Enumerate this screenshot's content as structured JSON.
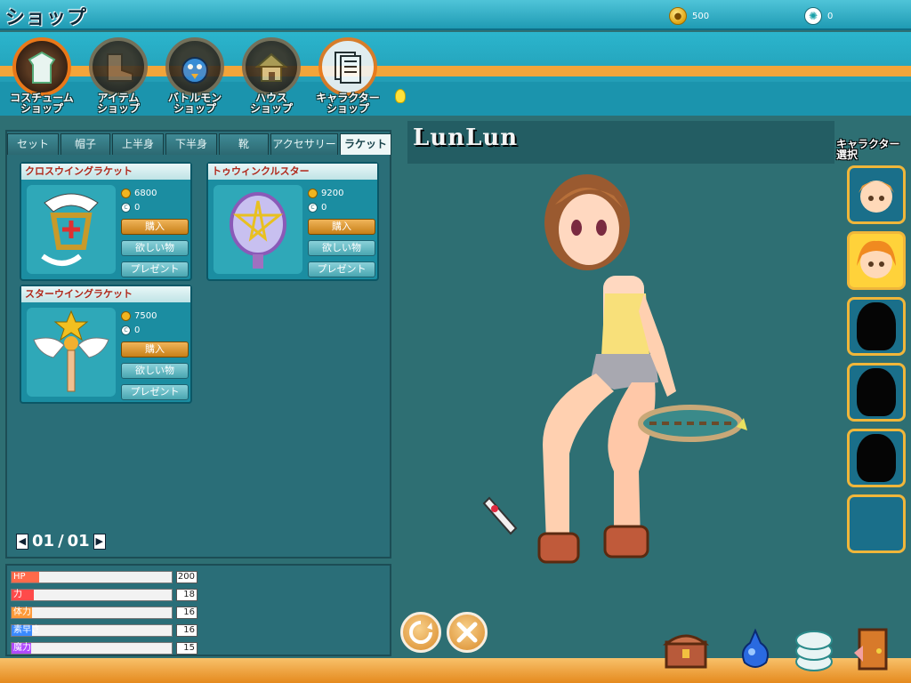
{
  "header": {
    "title": "ショップ",
    "gold": "500",
    "candy": "0"
  },
  "categories": [
    {
      "label_line1": "コスチューム",
      "label_line2": "ショップ",
      "icon": "costume-icon",
      "active": true
    },
    {
      "label_line1": "アイテム",
      "label_line2": "ショップ",
      "icon": "boot-icon",
      "active": false
    },
    {
      "label_line1": "バトルモン",
      "label_line2": "ショップ",
      "icon": "battlemon-icon",
      "active": false
    },
    {
      "label_line1": "ハウス",
      "label_line2": "ショップ",
      "icon": "house-icon",
      "active": false
    },
    {
      "label_line1": "キャラクター",
      "label_line2": "ショップ",
      "icon": "card-icon",
      "active": false
    }
  ],
  "tabs": [
    {
      "label": "セット",
      "active": false
    },
    {
      "label": "帽子",
      "active": false
    },
    {
      "label": "上半身",
      "active": false
    },
    {
      "label": "下半身",
      "active": false
    },
    {
      "label": "靴",
      "active": false
    },
    {
      "label": "アクセサリー",
      "active": false
    },
    {
      "label": "ラケット",
      "active": true
    }
  ],
  "items": [
    {
      "name": "クロスウイングラケット",
      "gold_price": "6800",
      "candy_price": "0"
    },
    {
      "name": "トゥウィンクルスター",
      "gold_price": "9200",
      "candy_price": "0"
    },
    {
      "name": "スターウイングラケット",
      "gold_price": "7500",
      "candy_price": "0"
    }
  ],
  "buttons": {
    "buy": "購入",
    "wish": "欲しい物",
    "gift": "プレゼント"
  },
  "pager": {
    "current": "01",
    "separator": "/",
    "total": "01"
  },
  "stats": [
    {
      "name": "HP",
      "value": "200",
      "level": 0.17,
      "color": "#ff6a4a"
    },
    {
      "name": "力",
      "value": "18",
      "level": 0.14,
      "color": "#ff4a4a"
    },
    {
      "name": "体力",
      "value": "16",
      "level": 0.13,
      "color": "#ff9a3a"
    },
    {
      "name": "素早さ",
      "value": "16",
      "level": 0.13,
      "color": "#3a8aff"
    },
    {
      "name": "魔力",
      "value": "15",
      "level": 0.12,
      "color": "#b04aff"
    }
  ],
  "character": {
    "name": "LunLun"
  },
  "character_select": {
    "label_line1": "キャラクター",
    "label_line2": "選択"
  },
  "colors": {
    "accent": "#f2a53a",
    "panel": "#2a6e78",
    "buy": "#c77f18"
  }
}
